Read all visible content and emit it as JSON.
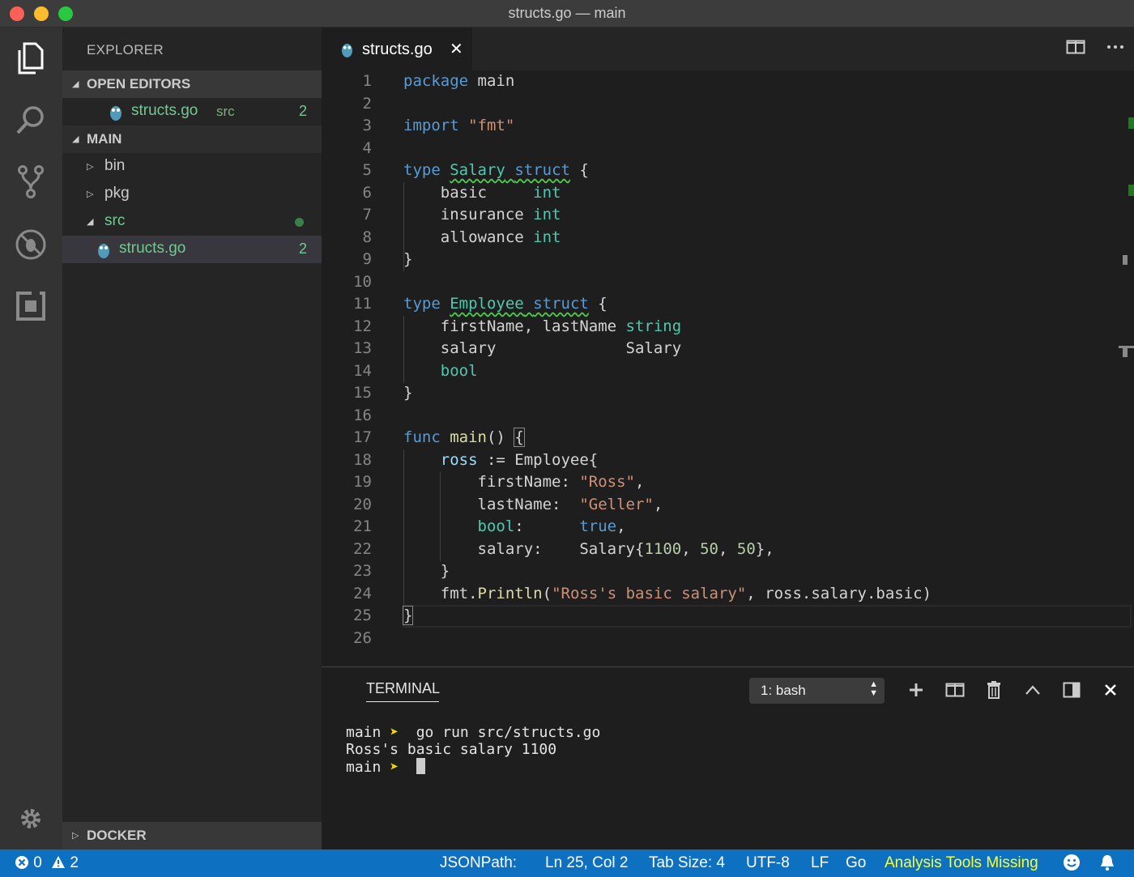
{
  "window": {
    "title": "structs.go — main"
  },
  "sidebar": {
    "title": "EXPLORER",
    "open_editors": {
      "label": "OPEN EDITORS",
      "files": [
        {
          "name": "structs.go",
          "folder": "src",
          "problems": "2"
        }
      ]
    },
    "main": {
      "label": "MAIN",
      "items": [
        {
          "name": "bin"
        },
        {
          "name": "pkg"
        },
        {
          "name": "src"
        },
        {
          "name": "structs.go",
          "problems": "2"
        }
      ]
    },
    "docker": {
      "label": "DOCKER"
    }
  },
  "editor": {
    "tab": {
      "label": "structs.go",
      "close": "✕"
    },
    "line_numbers": [
      "1",
      "2",
      "3",
      "4",
      "5",
      "6",
      "7",
      "8",
      "9",
      "10",
      "11",
      "12",
      "13",
      "14",
      "15",
      "16",
      "17",
      "18",
      "19",
      "20",
      "21",
      "22",
      "23",
      "24",
      "25",
      "26"
    ],
    "code": {
      "l1_kw": "package",
      "l1_rest": " main",
      "l3_kw": "import",
      "l3_str": "\"fmt\"",
      "l5_kw": "type",
      "l5_name": "Salary",
      "l5_struct": "struct",
      "l5_brace": " {",
      "l6_field": "basic     ",
      "l6_type": "int",
      "l7_field": "insurance ",
      "l7_type": "int",
      "l8_field": "allowance ",
      "l8_type": "int",
      "l9": "}",
      "l11_kw": "type",
      "l11_name": "Employee",
      "l11_struct": "struct",
      "l11_brace": " {",
      "l12_field": "firstName, lastName ",
      "l12_type": "string",
      "l13_field": "salary              ",
      "l13_type": "Salary",
      "l14_type": "bool",
      "l15": "}",
      "l17_kw": "func",
      "l17_fn": "main",
      "l17_rest": "() ",
      "l17_brace": "{",
      "l18_var": "ross",
      "l18_rest": " := Employee{",
      "l19_key": "firstName: ",
      "l19_str": "\"Ross\"",
      "l19_end": ",",
      "l20_key": "lastName:  ",
      "l20_str": "\"Geller\"",
      "l20_end": ",",
      "l21_key": "bool",
      "l21_colon": ":      ",
      "l21_val": "true",
      "l21_end": ",",
      "l22_key": "salary:    ",
      "l22_a": "Salary{",
      "l22_n1": "1100",
      "l22_c1": ", ",
      "l22_n2": "50",
      "l22_c2": ", ",
      "l22_n3": "50",
      "l22_end": "},",
      "l23": "}",
      "l24_a": "fmt.",
      "l24_fn": "Println",
      "l24_p": "(",
      "l24_str": "\"Ross's basic salary\"",
      "l24_rest": ", ross.salary.basic)",
      "l25": "}"
    }
  },
  "panel": {
    "title": "TERMINAL",
    "selector": "1: bash",
    "terminal": {
      "line1_dir": "main",
      "line1_arrow": "➤",
      "line1_cmd": "  go run src/structs.go",
      "line2": "Ross's basic salary 1100",
      "line3_dir": "main",
      "line3_arrow": "➤"
    }
  },
  "statusbar": {
    "errors": "0",
    "warnings": "2",
    "jsonpath": "JSONPath:",
    "position": "Ln 25, Col 2",
    "tab_size": "Tab Size: 4",
    "encoding": "UTF-8",
    "eol": "LF",
    "language": "Go",
    "analysis": "Analysis Tools Missing"
  },
  "colors": {
    "statusbar_bg": "#0e70c0",
    "accent_green": "#73c991",
    "analysis_warning": "#f6ff3c"
  }
}
